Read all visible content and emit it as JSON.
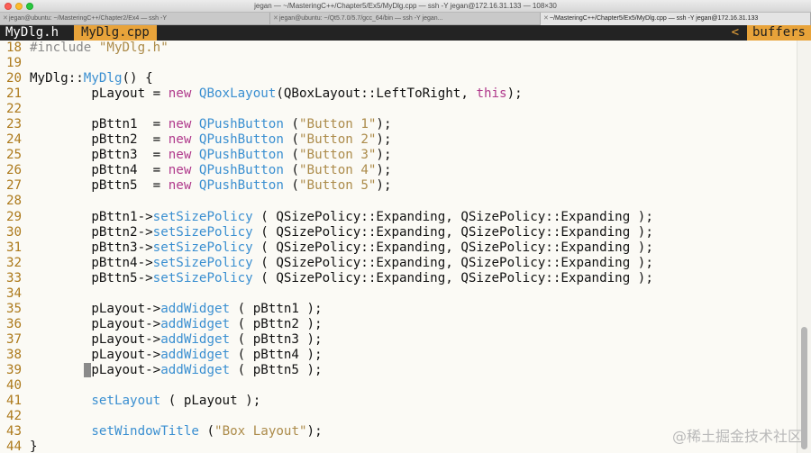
{
  "window": {
    "title": "jegan — ~/MasteringC++/Chapter5/Ex5/MyDlg.cpp — ssh -Y jegan@172.16.31.133 — 108×30"
  },
  "tabs": [
    {
      "label": "jegan@ubuntu: ~/MasteringC++/Chapter2/Ex4 — ssh -Y",
      "active": false
    },
    {
      "label": "jegan@ubuntu: ~/Qt5.7.0/5.7/gcc_64/bin — ssh -Y jegan...",
      "active": false
    },
    {
      "label": "~/MasteringC++/Chapter5/Ex5/MyDlg.cpp — ssh -Y jegan@172.16.31.133",
      "active": true
    }
  ],
  "buffers": {
    "items": [
      "MyDlg.h",
      "MyDlg.cpp"
    ],
    "active_index": 1,
    "right_arrow": "<",
    "right_label": "buffers"
  },
  "colors": {
    "keyword": "#b03a8c",
    "type": "#3a8fd1",
    "string": "#ac8b4a",
    "preproc": "#8a8a8a",
    "line_number": "#ad7a1c",
    "accent": "#e8a33a"
  },
  "code_lines": [
    {
      "n": "18",
      "tokens": [
        [
          "pre",
          "#include "
        ],
        [
          "str",
          "\"MyDlg.h\""
        ]
      ]
    },
    {
      "n": "19",
      "tokens": []
    },
    {
      "n": "20",
      "tokens": [
        [
          "plain",
          "MyDlg::"
        ],
        [
          "type",
          "MyDlg"
        ],
        [
          "plain",
          "() {"
        ]
      ]
    },
    {
      "n": "21",
      "tokens": [
        [
          "plain",
          "        pLayout = "
        ],
        [
          "kw",
          "new"
        ],
        [
          "plain",
          " "
        ],
        [
          "type",
          "QBoxLayout"
        ],
        [
          "plain",
          "(QBoxLayout::LeftToRight, "
        ],
        [
          "kw",
          "this"
        ],
        [
          "plain",
          ");"
        ]
      ]
    },
    {
      "n": "22",
      "tokens": []
    },
    {
      "n": "23",
      "tokens": [
        [
          "plain",
          "        pBttn1  = "
        ],
        [
          "kw",
          "new"
        ],
        [
          "plain",
          " "
        ],
        [
          "type",
          "QPushButton"
        ],
        [
          "plain",
          " ("
        ],
        [
          "str",
          "\"Button 1\""
        ],
        [
          "plain",
          ");"
        ]
      ]
    },
    {
      "n": "24",
      "tokens": [
        [
          "plain",
          "        pBttn2  = "
        ],
        [
          "kw",
          "new"
        ],
        [
          "plain",
          " "
        ],
        [
          "type",
          "QPushButton"
        ],
        [
          "plain",
          " ("
        ],
        [
          "str",
          "\"Button 2\""
        ],
        [
          "plain",
          ");"
        ]
      ]
    },
    {
      "n": "25",
      "tokens": [
        [
          "plain",
          "        pBttn3  = "
        ],
        [
          "kw",
          "new"
        ],
        [
          "plain",
          " "
        ],
        [
          "type",
          "QPushButton"
        ],
        [
          "plain",
          " ("
        ],
        [
          "str",
          "\"Button 3\""
        ],
        [
          "plain",
          ");"
        ]
      ]
    },
    {
      "n": "26",
      "tokens": [
        [
          "plain",
          "        pBttn4  = "
        ],
        [
          "kw",
          "new"
        ],
        [
          "plain",
          " "
        ],
        [
          "type",
          "QPushButton"
        ],
        [
          "plain",
          " ("
        ],
        [
          "str",
          "\"Button 4\""
        ],
        [
          "plain",
          ");"
        ]
      ]
    },
    {
      "n": "27",
      "tokens": [
        [
          "plain",
          "        pBttn5  = "
        ],
        [
          "kw",
          "new"
        ],
        [
          "plain",
          " "
        ],
        [
          "type",
          "QPushButton"
        ],
        [
          "plain",
          " ("
        ],
        [
          "str",
          "\"Button 5\""
        ],
        [
          "plain",
          ");"
        ]
      ]
    },
    {
      "n": "28",
      "tokens": []
    },
    {
      "n": "29",
      "tokens": [
        [
          "plain",
          "        pBttn1->"
        ],
        [
          "type",
          "setSizePolicy"
        ],
        [
          "plain",
          " ( QSizePolicy::Expanding, QSizePolicy::Expanding );"
        ]
      ]
    },
    {
      "n": "30",
      "tokens": [
        [
          "plain",
          "        pBttn2->"
        ],
        [
          "type",
          "setSizePolicy"
        ],
        [
          "plain",
          " ( QSizePolicy::Expanding, QSizePolicy::Expanding );"
        ]
      ]
    },
    {
      "n": "31",
      "tokens": [
        [
          "plain",
          "        pBttn3->"
        ],
        [
          "type",
          "setSizePolicy"
        ],
        [
          "plain",
          " ( QSizePolicy::Expanding, QSizePolicy::Expanding );"
        ]
      ]
    },
    {
      "n": "32",
      "tokens": [
        [
          "plain",
          "        pBttn4->"
        ],
        [
          "type",
          "setSizePolicy"
        ],
        [
          "plain",
          " ( QSizePolicy::Expanding, QSizePolicy::Expanding );"
        ]
      ]
    },
    {
      "n": "33",
      "tokens": [
        [
          "plain",
          "        pBttn5->"
        ],
        [
          "type",
          "setSizePolicy"
        ],
        [
          "plain",
          " ( QSizePolicy::Expanding, QSizePolicy::Expanding );"
        ]
      ]
    },
    {
      "n": "34",
      "tokens": []
    },
    {
      "n": "35",
      "tokens": [
        [
          "plain",
          "        pLayout->"
        ],
        [
          "type",
          "addWidget"
        ],
        [
          "plain",
          " ( pBttn1 );"
        ]
      ]
    },
    {
      "n": "36",
      "tokens": [
        [
          "plain",
          "        pLayout->"
        ],
        [
          "type",
          "addWidget"
        ],
        [
          "plain",
          " ( pBttn2 );"
        ]
      ]
    },
    {
      "n": "37",
      "tokens": [
        [
          "plain",
          "        pLayout->"
        ],
        [
          "type",
          "addWidget"
        ],
        [
          "plain",
          " ( pBttn3 );"
        ]
      ]
    },
    {
      "n": "38",
      "tokens": [
        [
          "plain",
          "        pLayout->"
        ],
        [
          "type",
          "addWidget"
        ],
        [
          "plain",
          " ( pBttn4 );"
        ]
      ]
    },
    {
      "n": "39",
      "tokens": [
        [
          "plain",
          "       "
        ],
        [
          "cursor",
          " "
        ],
        [
          "plain",
          "pLayout->"
        ],
        [
          "type",
          "addWidget"
        ],
        [
          "plain",
          " ( pBttn5 );"
        ]
      ]
    },
    {
      "n": "40",
      "tokens": []
    },
    {
      "n": "41",
      "tokens": [
        [
          "plain",
          "        "
        ],
        [
          "type",
          "setLayout"
        ],
        [
          "plain",
          " ( pLayout );"
        ]
      ]
    },
    {
      "n": "42",
      "tokens": []
    },
    {
      "n": "43",
      "tokens": [
        [
          "plain",
          "        "
        ],
        [
          "type",
          "setWindowTitle"
        ],
        [
          "plain",
          " ("
        ],
        [
          "str",
          "\"Box Layout\""
        ],
        [
          "plain",
          ");"
        ]
      ]
    },
    {
      "n": "44",
      "tokens": [
        [
          "plain",
          "}"
        ]
      ]
    }
  ],
  "watermark": "@稀土掘金技术社区"
}
